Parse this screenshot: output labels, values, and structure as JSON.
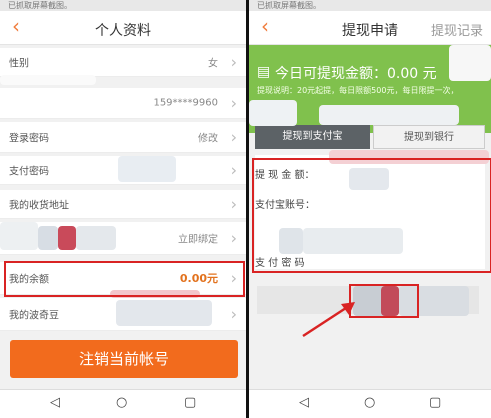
{
  "left": {
    "status_text": "已抓取屏幕截图。",
    "back_icon": "chevron-left",
    "title": "个人资料",
    "rows": {
      "gender": {
        "label": "性别",
        "value": "女"
      },
      "phone": {
        "value": "159****9960"
      },
      "login_password": {
        "label": "登录密码",
        "value": "修改"
      },
      "pay_password": {
        "label": "支付密码"
      },
      "address": {
        "label": "我的收货地址"
      },
      "bind": {
        "value": "立即绑定"
      },
      "balance": {
        "label": "我的余额",
        "value": "0.00元"
      },
      "bean": {
        "label": "我的波奇豆"
      }
    },
    "cancel_button": "注销当前帐号"
  },
  "right": {
    "status_text": "已抓取屏幕截图。",
    "title": "提现申请",
    "history_link": "提现记录",
    "today_label": "今日可提现金额：0.00 元",
    "rule_text": "提现说明：20元起提，每日限额500元，每日限提一次，",
    "tab_alipay": "提现到支付宝",
    "tab_bank": "提现到银行",
    "amount_label": "提 现 金 额：",
    "account_label": "支付宝账号：",
    "password_label": "支 付 密 码"
  },
  "colors": {
    "accent": "#f26b1d",
    "green": "#80c14d",
    "red_box": "#d92323"
  }
}
